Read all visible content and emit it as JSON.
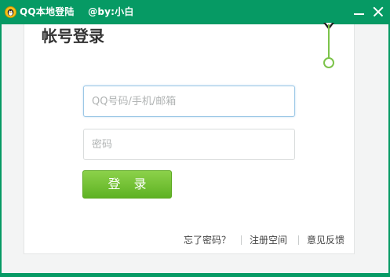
{
  "window": {
    "title": "QQ本地登陆",
    "author": "@by:小白",
    "accent_color": "#069a64",
    "logo_icon": "qq-penguin-icon",
    "minimize_icon": "minimize-icon",
    "close_icon": "close-icon"
  },
  "login": {
    "heading": "帐号登录",
    "account_placeholder": "QQ号码/手机/邮箱",
    "password_placeholder": "密码",
    "submit_label": "登 录",
    "button_color": "#6cbd2f"
  },
  "footer": {
    "forgot_password": "忘了密码？",
    "register_space": "注册空间",
    "feedback": "意见反馈"
  }
}
